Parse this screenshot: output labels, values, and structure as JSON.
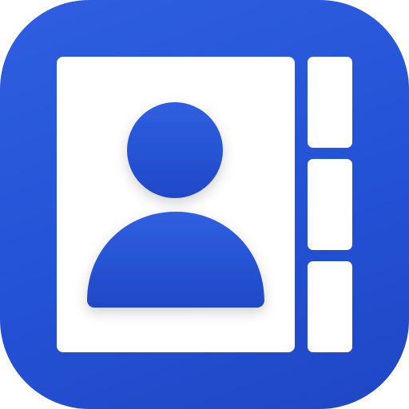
{
  "icon": {
    "name": "contacts-app-icon",
    "colors": {
      "background": "#2452d6",
      "page": "#ffffff",
      "avatar": "#2452d6"
    },
    "tabs": 3
  }
}
